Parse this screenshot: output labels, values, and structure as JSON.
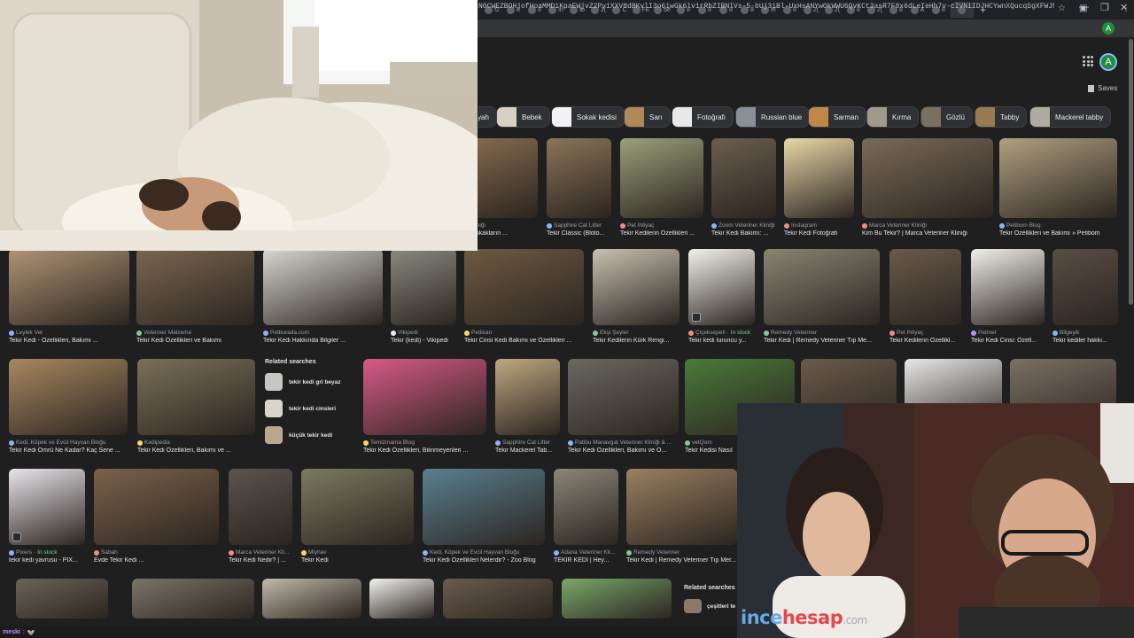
{
  "browser": {
    "tab_labels": [
      "f2",
      "8",
      "8",
      "in",
      "fb",
      "2(",
      "C",
      "FE",
      "be",
      "8",
      "8",
      "8",
      "8",
      "el",
      "8",
      "2(",
      "2(",
      "8",
      "2(",
      "8",
      "A",
      "8",
      ""
    ],
    "url": "N0CWEZBOHjofHoaMMDiKpaEWjvZ2Py1XXV8dBKvlI3o6iwGk6lv1rRbZIBNlVs-5-bUj3iBl-UxHsANYwOkWWU6QvKCt3asR7F8x6dLeIeHh7v-cIVNiIDJHCYwnXQucqSgXFWJMFrBsPKvc4qAoaWbDQw5K_yg7-09QZOk...",
    "new_tab_glyph": "+",
    "win_controls": [
      "—",
      "❐"
    ],
    "profile_letter": "A",
    "star_glyph": "☆"
  },
  "header": {
    "avatar_letter": "A",
    "saves_label": "Saves"
  },
  "chips": [
    {
      "label": "yah",
      "color": "#7a6048"
    },
    {
      "label": "Bebek",
      "color": "#d8d0c0"
    },
    {
      "label": "Sokak kedisi",
      "color": "#f2f2f2"
    },
    {
      "label": "Sarı",
      "color": "#b08858"
    },
    {
      "label": "Fotoğrafı",
      "color": "#e8e8e8"
    },
    {
      "label": "Russian blue",
      "color": "#8a8e96"
    },
    {
      "label": "Sarman",
      "color": "#c08848"
    },
    {
      "label": "Kırma",
      "color": "#a09a8a"
    },
    {
      "label": "Gözlü",
      "color": "#7a7060"
    },
    {
      "label": "Tabby",
      "color": "#9a7a52"
    },
    {
      "label": "Mackerel tabby",
      "color": "#b0aaa0"
    }
  ],
  "row1": [
    {
      "source": "er Kliniği",
      "title": "kımı: Sokakların ...",
      "color": "#8a6e52",
      "fav": "#9aa0a6"
    },
    {
      "source": "Sapphire Cat Litter",
      "title": "Tekir Classic (Bloto...",
      "color": "#8a7458",
      "fav": "#8ab4f8"
    },
    {
      "source": "Pet İhtiyaç",
      "title": "Tekir Kedilerin Özellikleri ...",
      "color": "#9aa07a",
      "fav": "#f28b82"
    },
    {
      "source": "Zoom Veteriner Kliniği",
      "title": "Tekir Kedi Bakımı: ...",
      "color": "#6a5e4e",
      "fav": "#8ab4f8"
    },
    {
      "source": "Instagram",
      "title": "Tekir Kedi Fotoğrafı",
      "color": "#e8d8a8",
      "fav": "#f28b82"
    },
    {
      "source": "Marca Veteriner Kliniği",
      "title": "Kim Bu Tekir? | Marca Veteriner Kliniği",
      "color": "#7a6a58",
      "fav": "#f28b82"
    },
    {
      "source": "Petibom Blog",
      "title": "Tekir Özellikleri ve Bakımı » Petibom",
      "color": "#b0a080",
      "fav": "#8ab4f8"
    }
  ],
  "row2": [
    {
      "source": "Leylek Vet",
      "title": "Tekir Kedi - Özellikleri, Bakımı ...",
      "color": "#b09474",
      "fav": "#8ab4f8"
    },
    {
      "source": "Veteriner Malzeme",
      "title": "Tekir Kedi Özellikleri ve Bakımı",
      "color": "#7a6650",
      "fav": "#81c995"
    },
    {
      "source": "Petburada.com",
      "title": "Tekir Kedi Hakkında Bilgiler ...",
      "color": "#d8d6d0",
      "fav": "#8ab4f8"
    },
    {
      "source": "Vikipedi",
      "title": "Tekir (kedi) - Vikipedi",
      "color": "#8a8a80",
      "fav": "#e8eaed"
    },
    {
      "source": "Petlican",
      "title": "Tekir Cinsi Kedi Bakımı ve Özellikleri ...",
      "color": "#6e5a42",
      "fav": "#fdd663"
    },
    {
      "source": "Ekşi Şeyler",
      "title": "Tekir Kedilerin Kürk Rengi...",
      "color": "#c8c0b0",
      "fav": "#81c995"
    },
    {
      "source": "Çiçeksepeti",
      "instock": "In stock",
      "title": "Tekir kedi turuncu y...",
      "color": "#f4f2ee",
      "fav": "#f28b82"
    },
    {
      "source": "Remedy Veteriner",
      "title": "Tekir Kedi | Remedy Veteriner Tıp Me...",
      "color": "#8a8474",
      "fav": "#81c995"
    },
    {
      "source": "Pet İhtiyaç",
      "title": "Tekir Kedilerin Özellikl...",
      "color": "#6a5a4a",
      "fav": "#f28b82"
    },
    {
      "source": "Petmer",
      "title": "Tekir Kedi Cinsi: Özell...",
      "color": "#f2f0ec",
      "fav": "#c58af9"
    },
    {
      "source": "Bilgeyik",
      "title": "Tekir kediler hakkı...",
      "color": "#5a4e44",
      "fav": "#8ab4f8"
    }
  ],
  "row3": [
    {
      "source": "Kedi, Köpek ve Evcil Hayvan Bloğu",
      "title": "Tekir Kedi Ömrü Ne Kadar? Kaç Sene ...",
      "color": "#a88860",
      "fav": "#8ab4f8"
    },
    {
      "source": "Kedipedia",
      "title": "Tekir Kedi Özellikleri, Bakımı ve ...",
      "color": "#7a7058",
      "fav": "#fdd663"
    },
    {
      "source": "Temizmama Blog",
      "title": "Tekir Kedi Özellikleri, Bilinmeyenleri ...",
      "color": "#d85a88",
      "fav": "#fdd663"
    },
    {
      "source": "Sapphire Cat Litter",
      "title": "Tekir Mackerel Tab...",
      "color": "#c0a880",
      "fav": "#8ab4f8"
    },
    {
      "source": "Patibu Manavgat Veteriner Kliniği & ...",
      "title": "Tekir Kedi Özellikleri, Bakımı ve Ö...",
      "color": "#6a6860",
      "fav": "#8ab4f8"
    },
    {
      "source": "vetQom",
      "title": "Tekir Kedisi Nasıl",
      "color": "#4a7a3a",
      "fav": "#81c995"
    },
    {
      "source": "",
      "title": "",
      "color": "#6a5a4a",
      "fav": "#9aa0a6"
    },
    {
      "source": "",
      "title": "",
      "color": "#e8e8e8",
      "fav": "#9aa0a6"
    },
    {
      "source": "",
      "title": "",
      "color": "#7a7064",
      "fav": "#9aa0a6"
    }
  ],
  "related": {
    "title": "Related searches",
    "items": [
      {
        "label": "tekir kedi gri beyaz",
        "color": "#c8c6c2"
      },
      {
        "label": "tekir kedi cinsleri",
        "color": "#d8d4cc"
      },
      {
        "label": "küçük tekir kedi",
        "color": "#b8a890"
      }
    ]
  },
  "row4": [
    {
      "source": "Pixers",
      "instock": "In stock",
      "title": "tekir kedi yavrusu - PIX...",
      "color": "#e8e4ea",
      "fav": "#8ab4f8"
    },
    {
      "source": "Sabah",
      "title": "Evde Tekir Kedi ...",
      "color": "#7a624a",
      "fav": "#f28b82"
    },
    {
      "source": "Marca Veteriner Kli...",
      "title": "Tekir Kedi Nedir? | ...",
      "color": "#5a5450",
      "fav": "#f28b82"
    },
    {
      "source": "Miyhav",
      "title": "Tekir Kedi",
      "color": "#7a7a60",
      "fav": "#fdd663"
    },
    {
      "source": "Kedi, Köpek ve Evcil Hayvan Bloğu",
      "title": "Tekir Kedi Özellikleri Nelerdir? - Zoo Blog",
      "color": "#5a8090",
      "fav": "#8ab4f8"
    },
    {
      "source": "Adana Veteriner Kli...",
      "title": "TEKİR KEDİ | Hey...",
      "color": "#8a8678",
      "fav": "#8ab4f8"
    },
    {
      "source": "Remedy Veteriner",
      "title": "Tekir Kedi | Remedy Veteriner Tıp Mer...",
      "color": "#9a8060",
      "fav": "#81c995"
    }
  ],
  "row5": [
    {
      "color": "#6a6458"
    },
    {
      "color": "#7a7468"
    },
    {
      "color": "#c0b8a8"
    },
    {
      "color": "#f2f2f0"
    },
    {
      "color": "#6a5c4e"
    },
    {
      "color": "#7aa86a"
    }
  ],
  "related2": {
    "title": "Related searches",
    "item": "çeşitleri te"
  },
  "watermark": {
    "part1": "ince",
    "part2": "hesap",
    "part3": ".com"
  },
  "chat": {
    "user": "meski",
    "sep": ":",
    "emote": "🐭"
  }
}
